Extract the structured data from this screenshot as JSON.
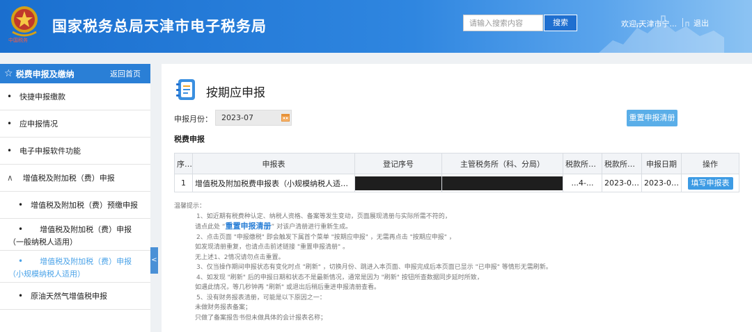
{
  "header": {
    "site_title": "国家税务总局天津市电子税务局",
    "logo_caption": "中国税务",
    "search_placeholder": "请输入搜索内容",
    "search_button": "搜索",
    "welcome": "欢迎,天津市宁...",
    "logout": "退出"
  },
  "sidebar": {
    "title": "税费申报及缴纳",
    "back": "返回首页",
    "items": [
      {
        "label": "快捷申报缴款"
      },
      {
        "label": "应申报情况"
      },
      {
        "label": "电子申报软件功能"
      }
    ],
    "group": {
      "caret": "∧",
      "label": "增值税及附加税（费）申报"
    },
    "sub_items": [
      {
        "label": "增值税及附加税（费）预缴申报"
      },
      {
        "label": "增值税及附加税（费）申报（一般纳税人适用）"
      },
      {
        "label": "增值税及附加税（费）申报（小规模纳税人适用）"
      },
      {
        "label": "原油天然气增值税申报"
      }
    ],
    "collapse": "<"
  },
  "main": {
    "title": "按期应申报",
    "month_label": "申报月份：",
    "month_value": "2023-07",
    "reset_button": "重置申报清册",
    "section_title": "税费申报",
    "table": {
      "headers": [
        "序号",
        "申报表",
        "登记序号",
        "主管税务所（科、分局）",
        "税款所属...",
        "税款所属...",
        "申报日期",
        "操作"
      ],
      "rows": [
        {
          "index": "1",
          "form": "增值税及附加税费申报表（小规模纳税人适用）",
          "reg_no": "",
          "office": "",
          "period_start": "...4-...",
          "period_end": "2023-06-...",
          "date": "2023-07-...",
          "action": "填写申报表"
        }
      ]
    },
    "notes": {
      "heading": "温馨提示：",
      "line1": "1、如近期有税费种认定、纳税人资格、备案等发生变动，页面展现清册与实际所需不符的，",
      "line2a": "请点此处",
      "line2_link": "重置申报清册",
      "line2b": "对该户清册进行重新生成。",
      "line3": "2、点击页面  \"申报缴税\"  即会触发下属首个菜单  \"按期应申报\"  ，无需再点击  \"按期应申报\"  ，",
      "line4": "如发现清册重复，也请点击前述链接  \"重置申报清册\"  。",
      "line5": "无上述1、2情况请勿点击重置。",
      "line6": "3、仅当操作期间申报状态有变化时点  \"刷新\"  ，切换月份、跳进入本页面、申报完成后本页面已显示  \"已申报\"  等情形无需刷新。",
      "line7": "4、如发现  \"刷新\"  后的申报日期和状态不是最新情况，通常是因为  \"刷新\"  按钮所查数据同步延时所致，",
      "line8": "如遇此情况，等几秒钟再  \"刷新\"  或退出后稍后重进申报清册查看。",
      "line9": "5、没有财务报表清册，可能是以下原因之一：",
      "line10": "未做财务报表备案；",
      "line11": "只做了备案报告书但未做具体的会计报表名称；"
    }
  }
}
